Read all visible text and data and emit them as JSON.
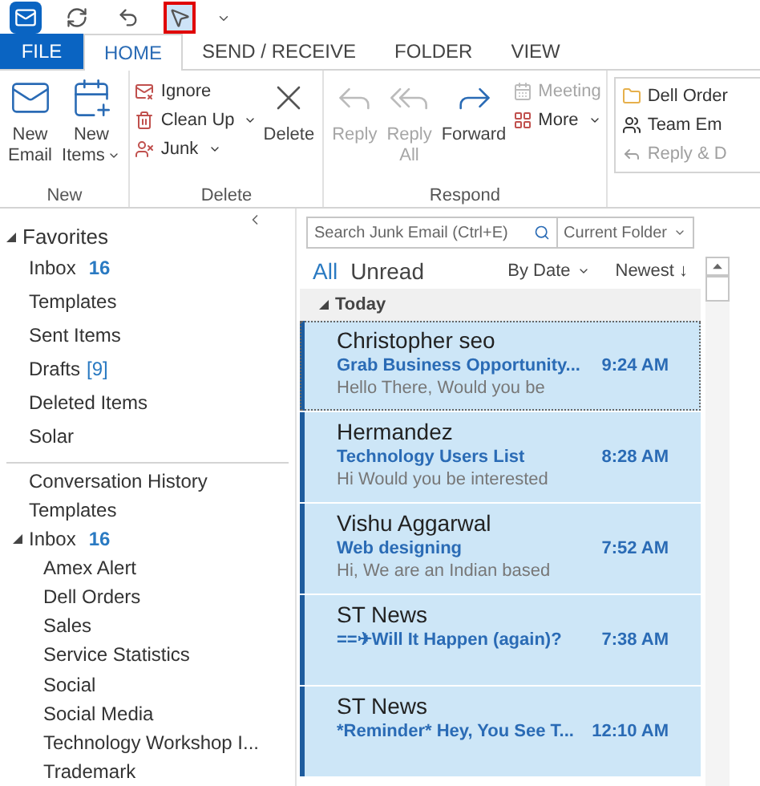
{
  "quick_access": [
    {
      "kind": "outlook",
      "highlighted": false
    },
    {
      "kind": "sendreceive",
      "highlighted": false
    },
    {
      "kind": "undo",
      "highlighted": false
    },
    {
      "kind": "touch",
      "highlighted": true
    },
    {
      "kind": "customize",
      "highlighted": false
    }
  ],
  "file_button": "FILE",
  "tabs": [
    {
      "label": "HOME",
      "selected": true
    },
    {
      "label": "SEND / RECEIVE",
      "selected": false
    },
    {
      "label": "FOLDER",
      "selected": false
    },
    {
      "label": "VIEW",
      "selected": false
    }
  ],
  "ribbon": {
    "groups": [
      {
        "label": "New",
        "items": [
          {
            "kind": "mail",
            "lines": [
              "New",
              "Email"
            ],
            "dropdown": false,
            "disabled": false
          },
          {
            "kind": "items",
            "lines": [
              "New",
              "Items"
            ],
            "dropdown": true,
            "disabled": false
          }
        ]
      },
      {
        "label": "Delete",
        "items": [
          {
            "children": [
              {
                "kind": "ignore",
                "label": "Ignore",
                "dropdown": false,
                "disabled": false
              },
              {
                "kind": "cleanup",
                "label": "Clean Up",
                "dropdown": true,
                "disabled": false
              },
              {
                "kind": "junk",
                "label": "Junk",
                "dropdown": true,
                "disabled": false
              }
            ]
          },
          {
            "kind": "delete",
            "lines": [
              "Delete"
            ],
            "dropdown": false,
            "disabled": false
          }
        ]
      },
      {
        "label": "Respond",
        "items": [
          {
            "kind": "reply",
            "lines": [
              "Reply"
            ],
            "dropdown": false,
            "disabled": true
          },
          {
            "kind": "replyall",
            "lines": [
              "Reply",
              "All"
            ],
            "dropdown": false,
            "disabled": true
          },
          {
            "kind": "forward",
            "lines": [
              "Forward"
            ],
            "dropdown": false,
            "disabled": false
          },
          {
            "children": [
              {
                "kind": "meeting",
                "label": "Meeting",
                "dropdown": false,
                "disabled": true
              },
              {
                "kind": "more",
                "label": "More",
                "dropdown": true,
                "disabled": false
              }
            ]
          }
        ]
      }
    ],
    "quick_steps": [
      {
        "kind": "folder",
        "label": "Dell Order",
        "disabled": false
      },
      {
        "kind": "team",
        "label": "Team Em",
        "disabled": false
      },
      {
        "kind": "replydelete",
        "label": "Reply & D",
        "disabled": true
      }
    ]
  },
  "sidebar": {
    "favorites": {
      "label": "Favorites",
      "expanded": true,
      "items": [
        {
          "label": "Inbox",
          "unread_count": "16"
        },
        {
          "label": "Templates"
        },
        {
          "label": "Sent Items"
        },
        {
          "label": "Drafts",
          "draft_count": "[9]"
        },
        {
          "label": "Deleted Items"
        },
        {
          "label": "Solar"
        }
      ]
    },
    "folders": [
      {
        "label": "Conversation History"
      },
      {
        "label": "Templates"
      },
      {
        "label": "Inbox",
        "unread_count": "16",
        "expanded": true,
        "children": [
          {
            "label": "Amex Alert"
          },
          {
            "label": "Dell Orders"
          },
          {
            "label": "Sales"
          },
          {
            "label": "Service Statistics"
          },
          {
            "label": "Social"
          },
          {
            "label": "Social Media"
          },
          {
            "label": "Technology Workshop I..."
          },
          {
            "label": "Trademark"
          }
        ]
      }
    ]
  },
  "search": {
    "placeholder": "Search Junk Email (Ctrl+E)",
    "scope": "Current Folder"
  },
  "filters": [
    {
      "label": "All",
      "selected": true
    },
    {
      "label": "Unread",
      "selected": false
    }
  ],
  "sort": {
    "by": "By Date",
    "order": "Newest ↓"
  },
  "group": {
    "label": "Today",
    "expanded": true
  },
  "messages": [
    {
      "sender": "Christopher seo",
      "subject": "Grab Business Opportunity...",
      "time": "9:24 AM",
      "preview": "Hello There,  Would you be",
      "selected": true,
      "focused": true
    },
    {
      "sender": "Hermandez",
      "subject": "Technology Users List",
      "time": "8:28 AM",
      "preview": "Hi  Would you be interested",
      "selected": true,
      "focused": false
    },
    {
      "sender": "Vishu Aggarwal",
      "subject": "Web designing",
      "time": "7:52 AM",
      "preview": "Hi,  We are an Indian based",
      "selected": true,
      "focused": false
    },
    {
      "sender": "ST News",
      "subject": "==✈Will It Happen (again)?",
      "time": "7:38 AM",
      "selected": true,
      "focused": false
    },
    {
      "sender": "ST News",
      "subject": "*Reminder* Hey, You See T...",
      "time": "12:10 AM",
      "selected": true,
      "focused": false
    }
  ]
}
